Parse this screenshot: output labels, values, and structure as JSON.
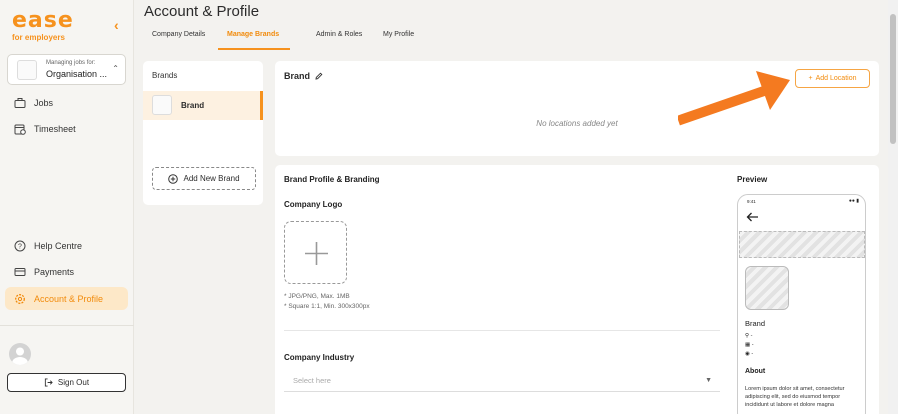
{
  "sidebar": {
    "logo": "ease",
    "logo_sub": "for employers",
    "org_label": "Managing jobs for:",
    "org_value": "Organisation ...",
    "nav_top": [
      "Jobs",
      "Timesheet"
    ],
    "nav_bottom": [
      "Help Centre",
      "Payments",
      "Account & Profile"
    ],
    "sign_out": "Sign Out"
  },
  "page": {
    "title": "Account & Profile",
    "tabs": [
      "Company Details",
      "Manage Brands",
      "Admin & Roles",
      "My Profile"
    ],
    "active_tab": "Manage Brands"
  },
  "brands": {
    "header": "Brands",
    "items": [
      "Brand"
    ],
    "add_label": "Add New Brand"
  },
  "brand_detail": {
    "title": "Brand",
    "add_location": "Add Location",
    "empty": "No locations added yet"
  },
  "profile": {
    "section": "Brand Profile & Branding",
    "logo_label": "Company Logo",
    "notes": [
      "* JPG/PNG, Max. 1MB",
      "* Square 1:1, Min. 300x300px"
    ],
    "industry_label": "Company Industry",
    "industry_placeholder": "Select here"
  },
  "preview": {
    "label": "Preview",
    "time": "9:41",
    "brand": "Brand",
    "meta": [
      "-",
      "-",
      "-"
    ],
    "about": "About",
    "about_text": "Lorem ipsum dolor sit amet, consectetur adipiscing elit, sed do eiusmod tempor incididunt ut labore et dolore magna"
  },
  "colors": {
    "accent": "#f6921e",
    "annotation_arrow": "#f47a20"
  }
}
